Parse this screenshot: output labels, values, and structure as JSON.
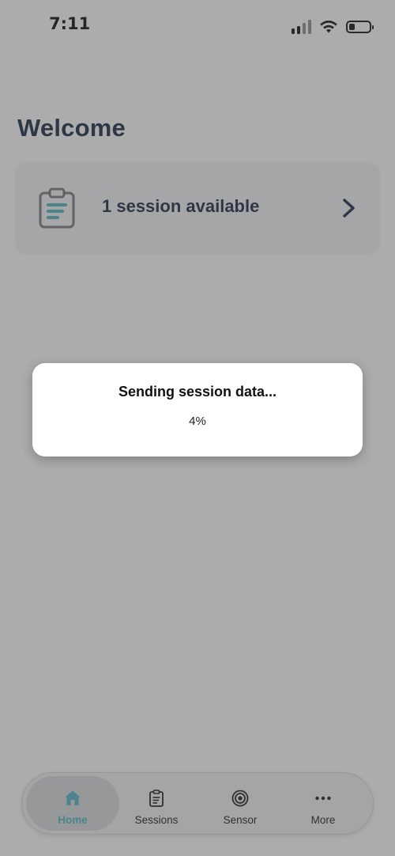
{
  "status_bar": {
    "time": "7:11",
    "signal_bars_total": 4,
    "signal_bars_active": 2,
    "battery_level_fraction": 0.3
  },
  "home": {
    "title": "Welcome",
    "session_card": {
      "label": "1 session available",
      "icon": "clipboard-icon"
    }
  },
  "modal": {
    "title": "Sending session data...",
    "progress_text": "4%"
  },
  "tab_bar": {
    "active": "home",
    "items": [
      {
        "id": "home",
        "label": "Home",
        "icon": "home-icon"
      },
      {
        "id": "sessions",
        "label": "Sessions",
        "icon": "clipboard-icon"
      },
      {
        "id": "sensor",
        "label": "Sensor",
        "icon": "target-icon"
      },
      {
        "id": "more",
        "label": "More",
        "icon": "ellipsis-icon"
      }
    ]
  },
  "colors": {
    "accent": "#4fb6c4",
    "title": "#1a2a44",
    "overlay": "rgba(70,70,70,0.45)"
  }
}
